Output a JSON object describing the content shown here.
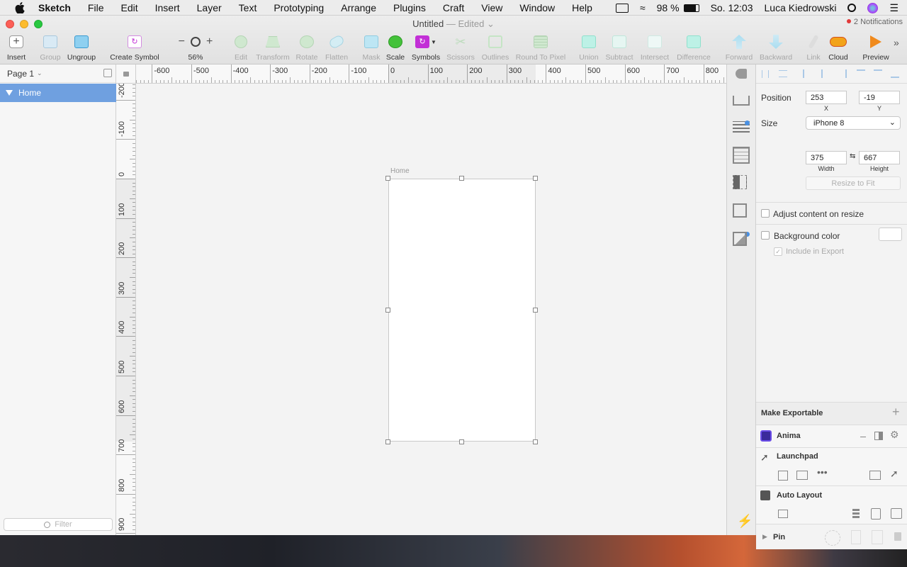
{
  "menubar": {
    "app": "Sketch",
    "items": [
      "File",
      "Edit",
      "Insert",
      "Layer",
      "Text",
      "Prototyping",
      "Arrange",
      "Plugins",
      "Craft",
      "View",
      "Window",
      "Help"
    ],
    "battery": "98 %",
    "clock": "So. 12:03",
    "user": "Luca Kiedrowski"
  },
  "document": {
    "title": "Untitled",
    "status": "— Edited",
    "notifications": "2 Notifications"
  },
  "toolbar": {
    "insert": "Insert",
    "group": "Group",
    "ungroup": "Ungroup",
    "create_symbol": "Create Symbol",
    "zoom": "56%",
    "edit": "Edit",
    "transform": "Transform",
    "rotate": "Rotate",
    "flatten": "Flatten",
    "mask": "Mask",
    "scale": "Scale",
    "symbols": "Symbols",
    "scissors": "Scissors",
    "outlines": "Outlines",
    "round_to_pixel": "Round To Pixel",
    "union": "Union",
    "subtract": "Subtract",
    "intersect": "Intersect",
    "difference": "Difference",
    "forward": "Forward",
    "backward": "Backward",
    "link": "Link",
    "cloud": "Cloud",
    "preview": "Preview"
  },
  "layers": {
    "page": "Page 1",
    "items": [
      "Home"
    ],
    "filter_placeholder": "Filter"
  },
  "rulers": {
    "top": [
      "-600",
      "-500",
      "-400",
      "-300",
      "-200",
      "-100",
      "0",
      "100",
      "200",
      "300",
      "400",
      "500",
      "600",
      "700",
      "800"
    ],
    "left": [
      "-200",
      "-100",
      "0",
      "100",
      "200",
      "300",
      "400",
      "500",
      "600",
      "700",
      "800",
      "900"
    ]
  },
  "canvas": {
    "artboard_name": "Home"
  },
  "inspector": {
    "position_label": "Position",
    "x": "253",
    "y": "-19",
    "x_label": "X",
    "y_label": "Y",
    "size_label": "Size",
    "preset": "iPhone 8",
    "width": "375",
    "height": "667",
    "width_label": "Width",
    "height_label": "Height",
    "resize_to_fit": "Resize to Fit",
    "adjust_content": "Adjust content on resize",
    "background_color": "Background color",
    "include_in_export": "Include in Export",
    "make_exportable": "Make Exportable",
    "anima": "Anima",
    "launchpad": "Launchpad",
    "auto_layout": "Auto Layout",
    "pin": "Pin"
  },
  "colors": {
    "selection": "#6fa0e0",
    "symbols_accent": "#c22fd6",
    "boolean_ops": "#5fe0c8",
    "scale_green": "#44c23a",
    "cloud_orange": "#f2a319"
  }
}
